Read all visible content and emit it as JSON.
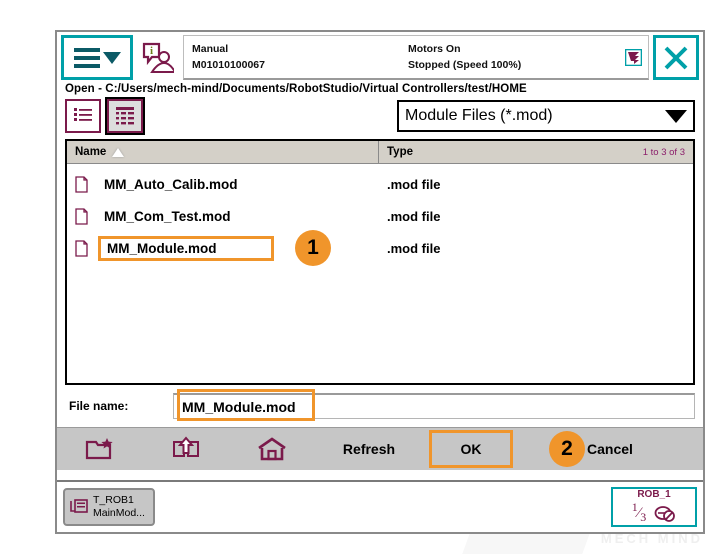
{
  "header": {
    "menu_icon": "hamburger-menu-icon",
    "chevron_icon": "chevron-down-icon",
    "operator_icon": "operator-info-icon",
    "mode": "Manual",
    "controller_id": "M01010100067",
    "motors_state": "Motors On",
    "run_state": "Stopped (Speed 100%)",
    "stop_icon": "emergency-stop-icon",
    "close_icon": "close-icon"
  },
  "pathbar": {
    "text": "Open  -  C:/Users/mech-mind/Documents/RobotStudio/Virtual  Controllers/test/HOME"
  },
  "toolbar": {
    "list_view_icon": "list-view-icon",
    "detail_view_icon": "detail-view-icon",
    "filter_value": "Module Files (*.mod)",
    "filter_caret_icon": "chevron-down-icon"
  },
  "filelist": {
    "columns": {
      "name": "Name",
      "type": "Type"
    },
    "sort_icon": "sort-ascending-icon",
    "count": "1 to 3 of 3",
    "rows": [
      {
        "icon": "file-icon",
        "name": "MM_Auto_Calib.mod",
        "type": ".mod file",
        "highlighted": false
      },
      {
        "icon": "file-icon",
        "name": "MM_Com_Test.mod",
        "type": ".mod file",
        "highlighted": false
      },
      {
        "icon": "file-icon",
        "name": "MM_Module.mod",
        "type": ".mod file",
        "highlighted": true
      }
    ]
  },
  "filename": {
    "label": "File name:",
    "value": "MM_Module.mod",
    "placeholder": ""
  },
  "actions": {
    "new_folder_icon": "new-folder-icon",
    "up_level_icon": "up-one-level-icon",
    "home_icon": "home-icon",
    "refresh": "Refresh",
    "ok": "OK",
    "cancel": "Cancel"
  },
  "annotations": {
    "badge_one": "1",
    "badge_two": "2",
    "color": "#f0952b"
  },
  "taskbar": {
    "task_icon": "program-task-icon",
    "task_line1": "T_ROB1",
    "task_line2": "MainMod...",
    "jog_title": "ROB_1",
    "jog_numerator": "1",
    "jog_denominator": "3",
    "jog_icon": "jog-disabled-icon"
  },
  "watermark": {
    "text": "MECH MIND"
  },
  "colors": {
    "accent_teal": "#00a0a8",
    "accent_purple": "#7b1a4b",
    "annotation_orange": "#f0952b",
    "header_gray": "#d4d0c8",
    "actionbar_gray": "#c6c6c6"
  }
}
